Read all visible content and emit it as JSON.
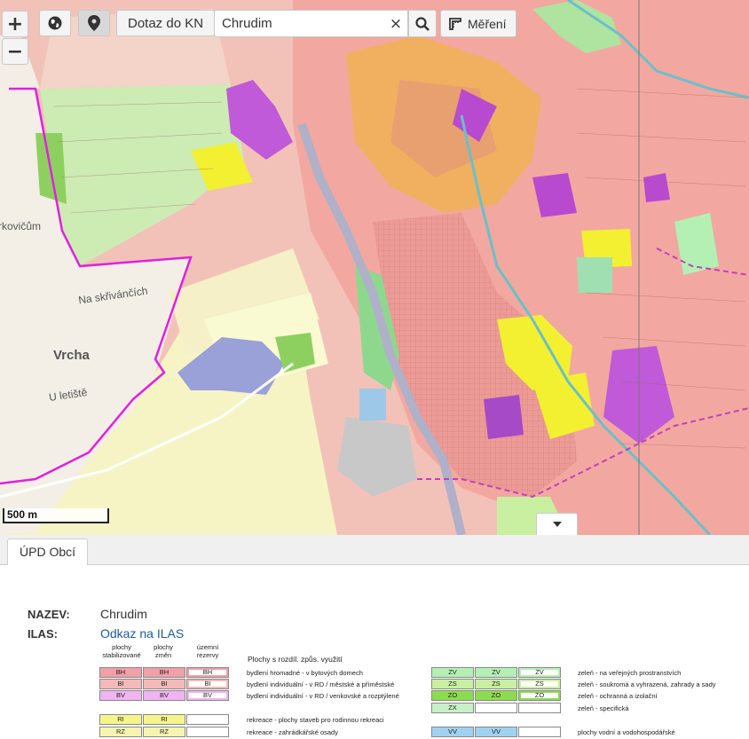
{
  "toolbar": {
    "zoom_in": "+",
    "zoom_out": "−",
    "kn_query_label": "Dotaz do KN",
    "search_value": "Chrudim",
    "search_clear": "×",
    "measure_label": "Měření"
  },
  "map": {
    "place_labels": [
      "rkovičům",
      "Na skřivánčích",
      "Vrcha",
      "U letiště"
    ],
    "scale_label": "500 m"
  },
  "tabs": [
    {
      "label": "ÚPD Obcí"
    }
  ],
  "info": {
    "nazev_key": "NAZEV:",
    "nazev_value": "Chrudim",
    "ilas_key": "ILAS:",
    "ilas_link": "Odkaz na ILAS"
  },
  "legend": {
    "col_headers": [
      "plochy stabilizované",
      "plochy změn",
      "územní rezervy"
    ],
    "section_title": "Plochy s rozdíl. způs. využití",
    "left_rows": [
      {
        "codes": [
          "BH",
          "BH",
          "BH"
        ],
        "text": "bydlení hromadné - v bytových domech",
        "color": "#f0a0a8"
      },
      {
        "codes": [
          "BI",
          "BI",
          "BI"
        ],
        "text": "bydlení individuální - v RD / městské a příměstské",
        "color": "#f5b9b9"
      },
      {
        "codes": [
          "BV",
          "BV",
          "BV"
        ],
        "text": "bydlení individuální - v RD / venkovské a rozptýlené",
        "color": "#f0b4f0"
      },
      {
        "codes": [
          "RI",
          "RI",
          ""
        ],
        "text": "rekreace - plochy staveb pro rodinnou rekreaci",
        "color": "#f5f58c"
      },
      {
        "codes": [
          "RZ",
          "RZ",
          ""
        ],
        "text": "rekreace - zahrádkářské osady",
        "color": "#f5f5b0"
      }
    ],
    "right_rows": [
      {
        "codes": [
          "ZV",
          "ZV",
          "ZV"
        ],
        "text": "zeleň - na veřejných prostranstvích",
        "color": "#b4f0b4"
      },
      {
        "codes": [
          "ZS",
          "ZS",
          "ZS"
        ],
        "text": "zeleň - soukromá a vyhrazená, zahrady a sady",
        "color": "#c8f0a0"
      },
      {
        "codes": [
          "ZO",
          "ZO",
          "ZO"
        ],
        "text": "zeleň - ochranná a izolační",
        "color": "#8cdc50"
      },
      {
        "codes": [
          "ZX",
          "",
          ""
        ],
        "text": "zeleň - specifická",
        "color": "#c8f0c8"
      },
      {
        "codes": [
          "VV",
          "VV",
          ""
        ],
        "text": "plochy vodní a vodohospodářské",
        "color": "#a0d2f0"
      }
    ]
  }
}
